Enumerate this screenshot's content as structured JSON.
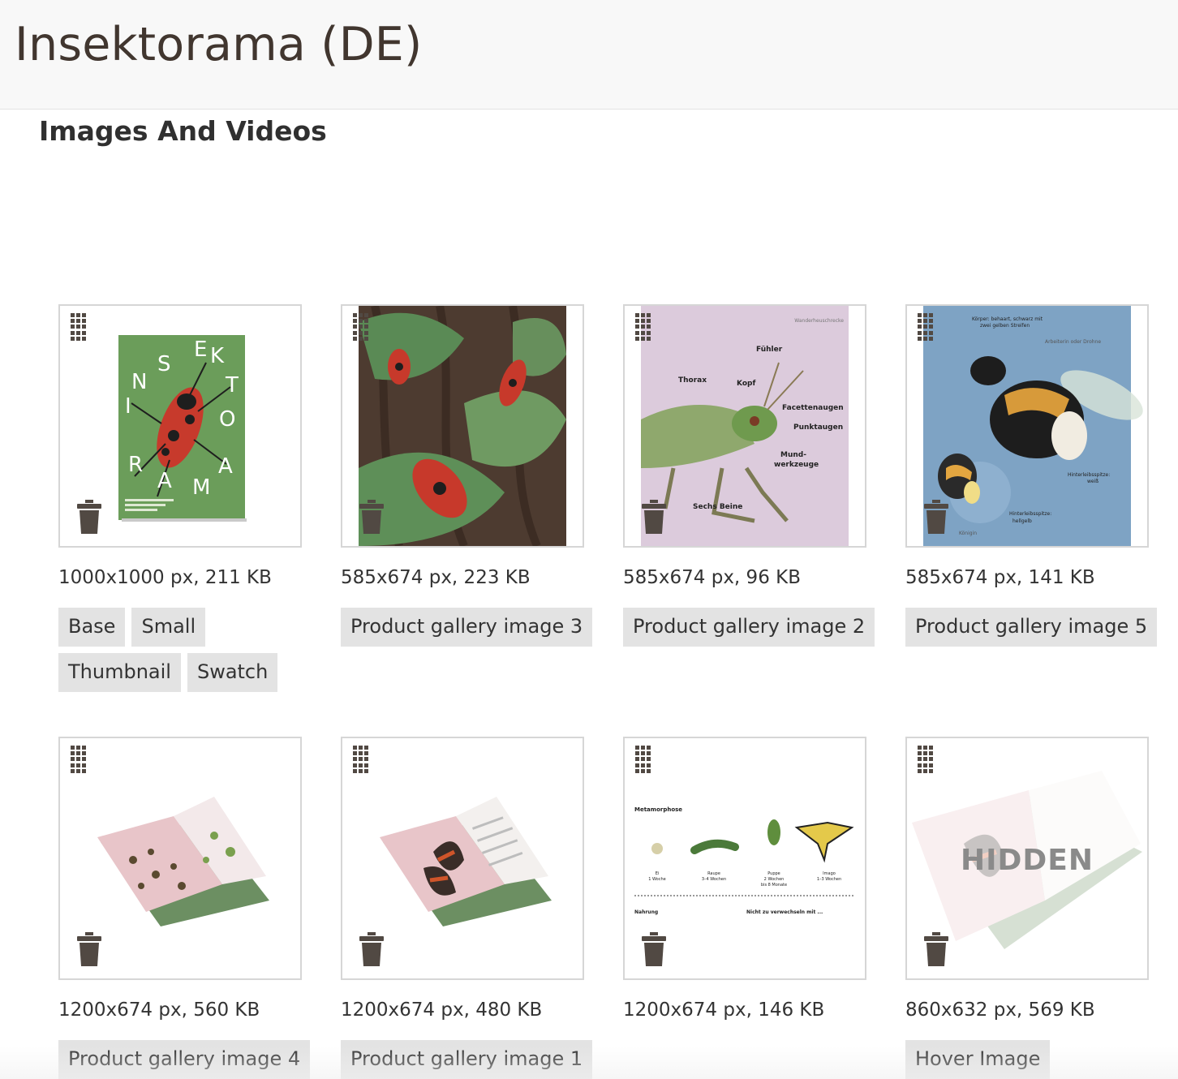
{
  "header": {
    "title": "Insektorama (DE)"
  },
  "section": {
    "title": "Images And Videos"
  },
  "hidden_label": "HIDDEN",
  "images": [
    {
      "meta": "1000x1000 px, 211 KB",
      "roles": [
        "Base",
        "Small",
        "Thumbnail",
        "Swatch"
      ],
      "image": "book-cover-firebug"
    },
    {
      "meta": "585x674 px, 223 KB",
      "roles": [
        "Product gallery image 3"
      ],
      "image": "firebugs-on-ivy"
    },
    {
      "meta": "585x674 px, 96 KB",
      "roles": [
        "Product gallery image 2"
      ],
      "image": "grasshopper-anatomy",
      "labels": {
        "header": "Wanderheuschrecke",
        "antennae": "Fühler",
        "thorax": "Thorax",
        "head": "Kopf",
        "compound_eyes": "Facettenaugen",
        "ocelli": "Punktaugen",
        "mouthparts_1": "Mund-",
        "mouthparts_2": "werkzeuge",
        "legs": "Sechs Beine"
      }
    },
    {
      "meta": "585x674 px, 141 KB",
      "roles": [
        "Product gallery image 5"
      ],
      "image": "bumblebee-anatomy",
      "labels": {
        "body_1": "Körper: behaart, schwarz mit",
        "body_2": "zwei gelben Streifen",
        "workers": "Arbeiterin oder Drohne",
        "tip_1": "Hinterleibsspitze:",
        "tip_2": "weiß",
        "tip_3": "Hinterleibsspitze:",
        "tip_4": "hellgelb",
        "queen": "Königin"
      }
    },
    {
      "meta": "1200x674 px, 560 KB",
      "roles": [
        "Product gallery image 4"
      ],
      "image": "open-book-insects"
    },
    {
      "meta": "1200x674 px, 480 KB",
      "roles": [
        "Product gallery image 1"
      ],
      "image": "open-book-butterfly"
    },
    {
      "meta": "1200x674 px, 146 KB",
      "roles": [],
      "image": "metamorphosis-page",
      "labels": {
        "title": "Metamorphose",
        "egg": "Ei",
        "egg_time": "1 Woche",
        "larva": "Raupe",
        "larva_time": "3–4 Wochen",
        "pupa": "Puppe",
        "pupa_time_1": "2 Wochen",
        "pupa_time_2": "bis 8 Monate",
        "imago": "Imago",
        "imago_time": "1–3 Wochen",
        "food": "Nahrung",
        "confuse": "Nicht zu verwechseln mit ..."
      }
    },
    {
      "meta": "860x632 px, 569 KB",
      "roles": [
        "Hover Image"
      ],
      "image": "open-book-hidden",
      "hidden": true
    }
  ]
}
